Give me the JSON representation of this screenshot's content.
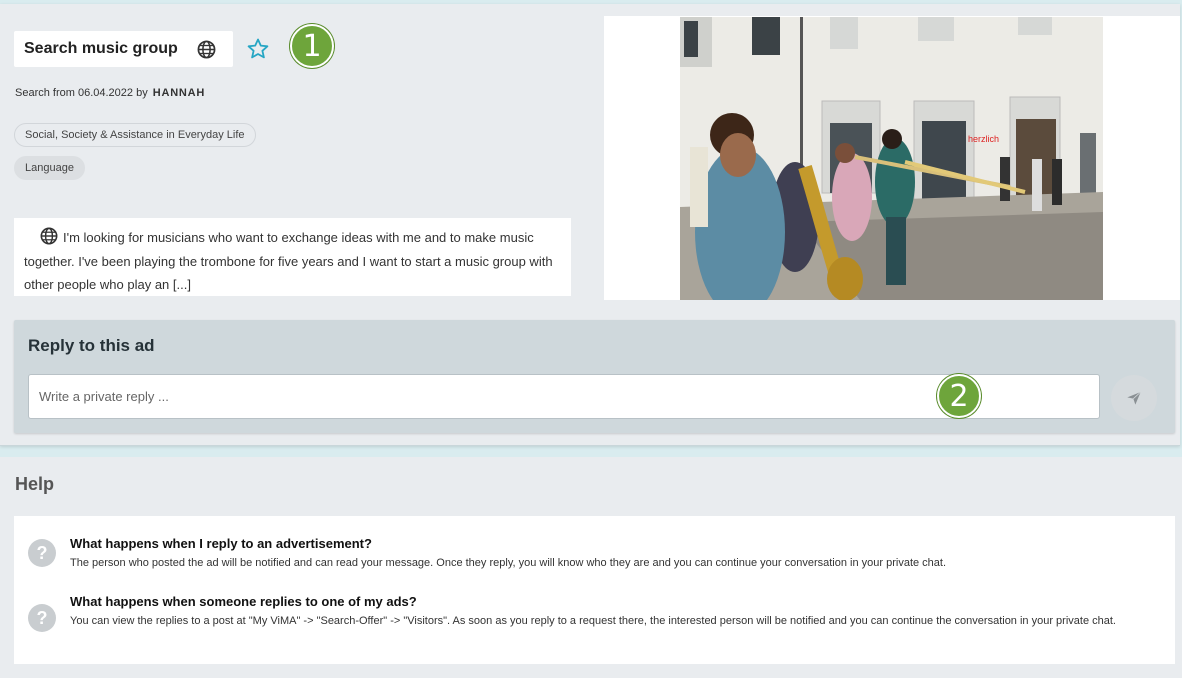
{
  "ad": {
    "title": "Search music group",
    "meta_prefix": "Search from 06.04.2022 by",
    "author": "HANNAH",
    "tags": [
      "Social, Society & Assistance in Everyday Life",
      "Language"
    ],
    "description": "I'm looking for musicians who want to exchange ideas with me and to make music together.  I've been playing the trombone for five years and I want to start a music group with other people who play an [...]",
    "icons": {
      "visibility": "globe-icon",
      "favorite": "star-icon"
    }
  },
  "callouts": [
    "1",
    "2"
  ],
  "reply": {
    "title": "Reply to this ad",
    "placeholder": "Write a private reply ...",
    "send_icon": "send-icon"
  },
  "help": {
    "title": "Help",
    "items": [
      {
        "question": "What happens when I reply to an advertisement?",
        "answer": "The person who posted the ad will be notified and can read your message. Once they reply, you will know who they are and you can continue your conversation in your private chat."
      },
      {
        "question": "What happens when someone replies to one of my ads?",
        "answer": "You can view the replies to a post at \"My ViMA\" -> \"Search-Offer\" -> \"Visitors\". As soon as you reply to a request there, the interested person will be notified and you can continue the conversation in your private chat."
      }
    ]
  },
  "colors": {
    "accent": "#26a6c4",
    "callout": "#6ea53b",
    "panel": "#cfd8dc"
  }
}
